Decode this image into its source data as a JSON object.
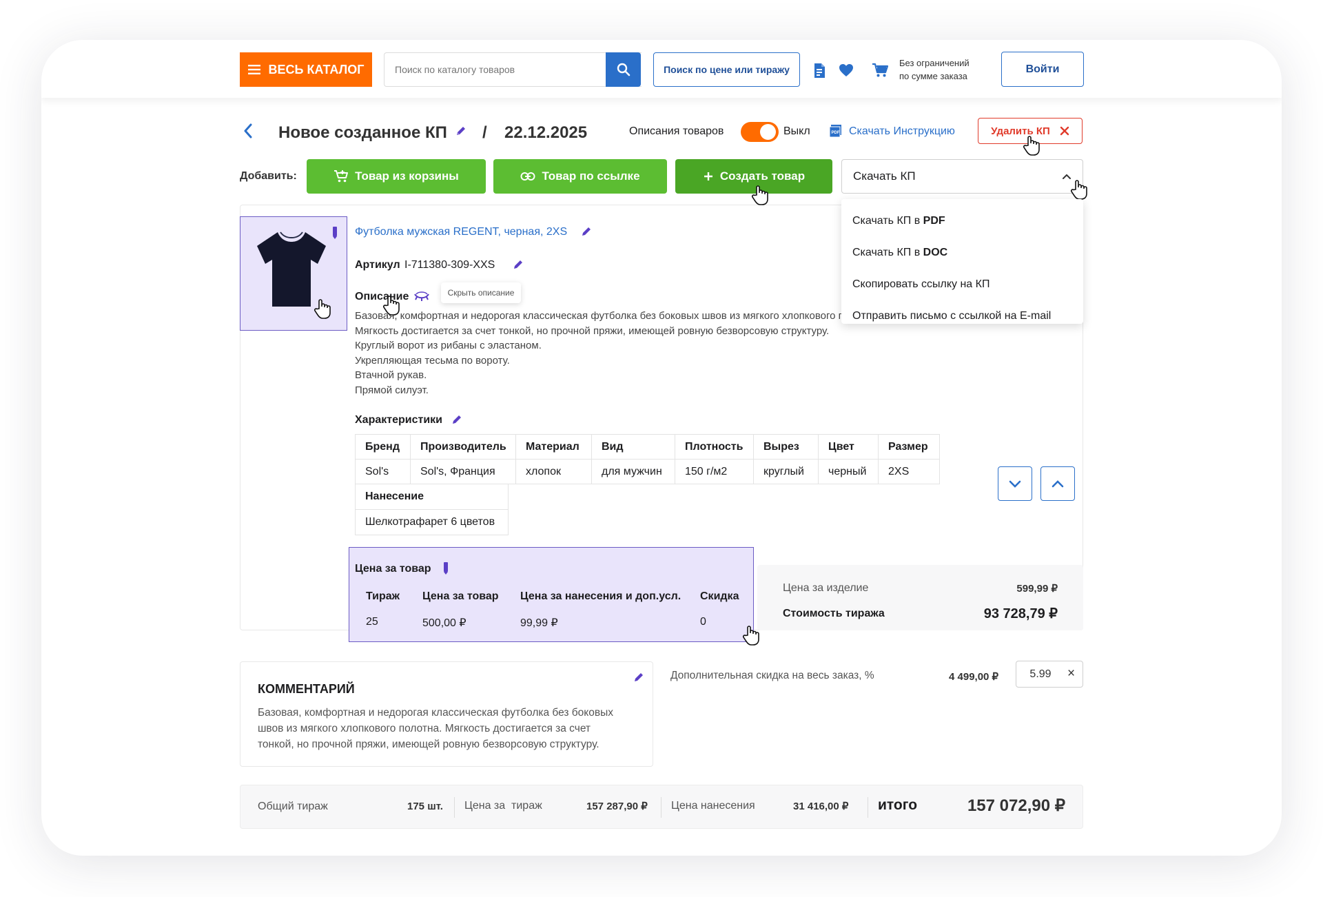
{
  "header": {
    "catalog_label": "ВЕСЬ КАТАЛОГ",
    "search_placeholder": "Поиск по каталогу товаров",
    "price_search_label": "Поиск по цене или тиражу",
    "limit_text_1": "Без ограничений",
    "limit_text_2": "по сумме заказа",
    "login_label": "Войти",
    "icons": [
      "catalog-menu-icon",
      "search-icon",
      "document-icon",
      "heart-icon",
      "cart-icon"
    ]
  },
  "toolbar": {
    "title": "Новое созданное КП",
    "separator": "/",
    "date": "22.12.2025",
    "descriptions_label": "Описания товаров",
    "toggle_state": "Выкл",
    "download_instruction": "Скачать Инструкцию",
    "delete_label": "Удалить КП",
    "add_label": "Добавить:",
    "from_cart": "Товар из корзины",
    "by_link": "Товар по ссылке",
    "create_product": "Создать товар",
    "download_select": "Скачать КП"
  },
  "download_menu": {
    "items": [
      {
        "prefix": "Скачать КП в ",
        "bold": "PDF"
      },
      {
        "prefix": "Скачать КП в ",
        "bold": "DOC"
      },
      {
        "prefix": "Скопировать ссылку на КП",
        "bold": ""
      },
      {
        "prefix": "Отправить письмо с ссылкой на E-mail",
        "bold": ""
      }
    ]
  },
  "product": {
    "name": "Футболка мужская REGENT, черная, 2XS",
    "article_label": "Артикул",
    "article_value": "I-711380-309-XXS",
    "description_label": "Описание",
    "hide_description_tooltip": "Скрыть описание",
    "description_lines": [
      "Базовая, комфортная и недорогая классическая футболка без боковых швов из мягкого хлопкового полотна.",
      "Мягкость достигается за счет тонкой, но прочной пряжи, имеющей ровную безворсовую структуру.",
      "Круглый ворот из рибаны с эластаном.",
      "Укрепляющая тесьма по вороту.",
      "Втачной рукав.",
      "Прямой силуэт."
    ],
    "characteristics_label": "Характеристики",
    "char_headers": [
      "Бренд",
      "Производитель",
      "Материал",
      "Вид",
      "Плотность",
      "Вырез",
      "Цвет",
      "Размер"
    ],
    "char_values": [
      "Sol's",
      "Sol's, Франция",
      "хлопок",
      "для мужчин",
      "150 г/м2",
      "круглый",
      "черный",
      "2XS"
    ],
    "application_header": "Нанесение",
    "application_value": "Шелкотрафарет 6 цветов"
  },
  "pricing": {
    "title": "Цена за товар",
    "headers": [
      "Тираж",
      "Цена за товар",
      "Цена за нанесения и доп.усл.",
      "Скидка"
    ],
    "values": [
      "25",
      "500,00 ₽",
      "99,99 ₽",
      "0"
    ],
    "item_price_label": "Цена за изделие",
    "item_price_value": "599,99 ₽",
    "run_cost_label": "Стоимость тиража",
    "run_cost_value": "93 728,79 ₽"
  },
  "comment": {
    "title": "КОММЕНТАРИЙ",
    "lines": [
      "Базовая, комфортная и недорогая классическая футболка без боковых",
      "швов из мягкого хлопкового полотна. Мягкость достигается за счет",
      "тонкой, но прочной пряжи, имеющей ровную безворсовую структуру."
    ]
  },
  "discount": {
    "label": "Дополнительная скидка на весь заказ, %",
    "amount": "4 499,00 ₽",
    "input_value": "5.99",
    "clear_symbol": "×"
  },
  "totals": {
    "total_run_label": "Общий тираж",
    "total_run_value": "175 шт.",
    "run_price_label": "Цена за  тираж",
    "run_price_value": "157 287,90 ₽",
    "application_price_label": "Цена нанесения",
    "application_price_value": "31 416,00 ₽",
    "grand_label": "итого",
    "grand_value": "157 072,90 ₽"
  },
  "colors": {
    "accent_orange": "#ff6b00",
    "primary_blue": "#2a6fc9",
    "green": "#5cbd32",
    "dark_green": "#4aa625",
    "danger": "#e03a2a",
    "lavender": "#e9e4fb",
    "violet_edit": "#5b3fc6"
  }
}
